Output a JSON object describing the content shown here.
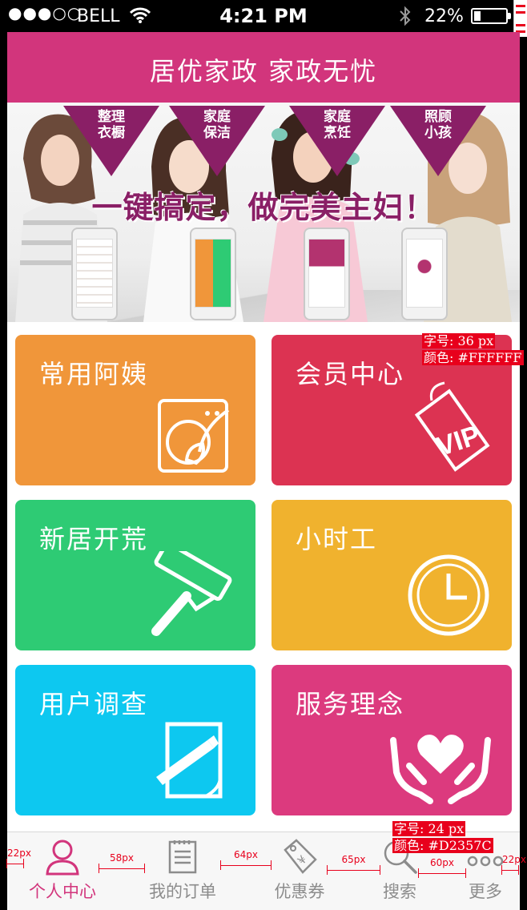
{
  "status_bar": {
    "signal": "●●●○○",
    "carrier": "BELL",
    "time": "4:21 PM",
    "battery_percent": "22%",
    "battery_level": 0.22
  },
  "header": {
    "title": "居优家政 家政无忧"
  },
  "banner": {
    "flags": [
      {
        "label": "整理\n衣橱"
      },
      {
        "label": "家庭\n保洁"
      },
      {
        "label": "家庭\n烹饪"
      },
      {
        "label": "照顾\n小孩"
      }
    ],
    "slogan": "一键搞定，做完美主妇！",
    "colors": {
      "flag": "#8a1f66",
      "slogan": "#8a1f66"
    }
  },
  "tiles": [
    {
      "label": "常用阿姨",
      "color": "#f0963a",
      "icon": "washing-machine-icon"
    },
    {
      "label": "会员中心",
      "color": "#dc3352",
      "icon": "vip-tag-icon"
    },
    {
      "label": "新居开荒",
      "color": "#2ecb74",
      "icon": "paint-roller-icon"
    },
    {
      "label": "小时工",
      "color": "#f0b22e",
      "icon": "clock-icon"
    },
    {
      "label": "用户调查",
      "color": "#0dc8f0",
      "icon": "note-pencil-icon"
    },
    {
      "label": "服务理念",
      "color": "#dc3a7e",
      "icon": "heart-hands-icon"
    }
  ],
  "tabbar": {
    "tabs": [
      {
        "label": "个人中心",
        "icon": "person-icon",
        "active": true
      },
      {
        "label": "我的订单",
        "icon": "document-icon",
        "active": false
      },
      {
        "label": "优惠券",
        "icon": "coupon-tag-icon",
        "active": false
      },
      {
        "label": "搜索",
        "icon": "search-icon",
        "active": false
      },
      {
        "label": "更多",
        "icon": "more-dots-icon",
        "active": false
      }
    ],
    "active_color": "#d2357c",
    "inactive_color": "#8c8c8c"
  },
  "annotations": {
    "tile_font_size": "字号: 36 px",
    "tile_font_color": "颜色: #FFFFFF",
    "tab_font_size": "字号: 24 px",
    "tab_font_color": "颜色: #D2357C",
    "spacings": [
      "22px",
      "58px",
      "64px",
      "65px",
      "60px",
      "22px"
    ]
  }
}
